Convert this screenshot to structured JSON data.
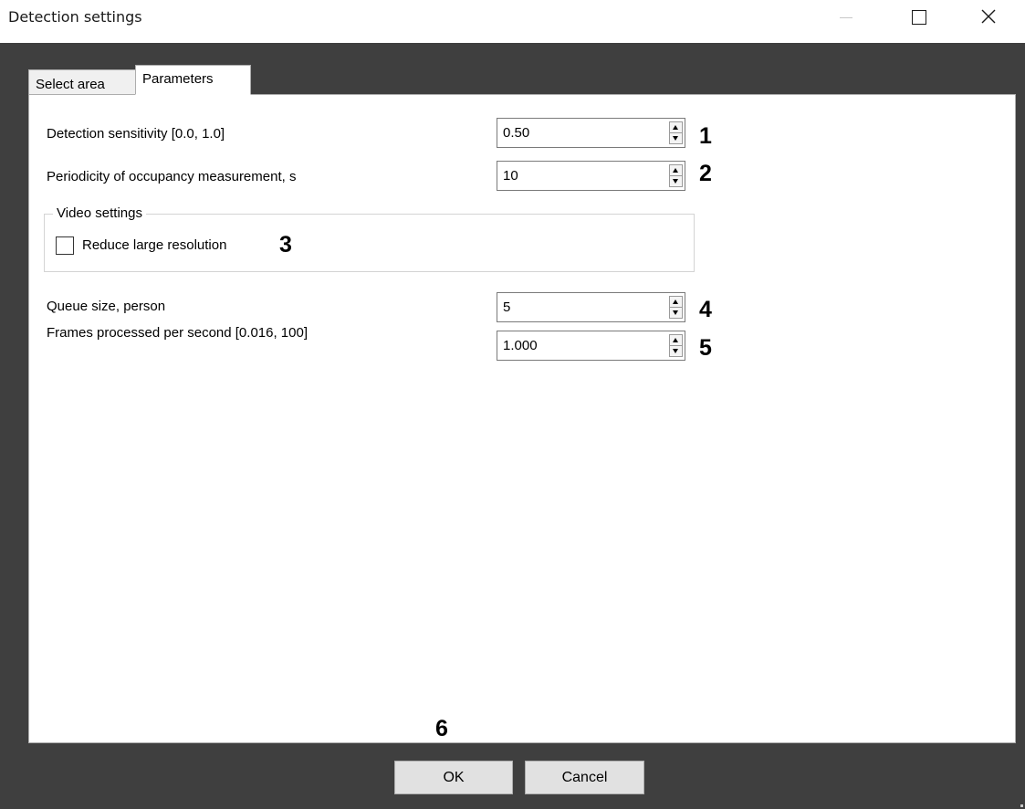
{
  "window": {
    "title": "Detection settings",
    "minimize_icon": "minimize-icon",
    "maximize_icon": "maximize-icon",
    "close_icon": "close-icon"
  },
  "tabs": [
    {
      "label": "Select area",
      "active": false
    },
    {
      "label": "Parameters",
      "active": true
    }
  ],
  "fields": {
    "sensitivity": {
      "label": "Detection sensitivity [0.0, 1.0]",
      "value": "0.50",
      "callout": "1"
    },
    "periodicity": {
      "label": "Periodicity of occupancy measurement, s",
      "value": "10",
      "callout": "2"
    },
    "queue_size": {
      "label": "Queue size, person",
      "value": "5",
      "callout": "4"
    },
    "fps": {
      "label": "Frames processed per second [0.016, 100]",
      "value": "1.000",
      "callout": "5"
    }
  },
  "video_settings": {
    "title": "Video settings",
    "reduce_resolution": {
      "label": "Reduce large resolution",
      "checked": false,
      "callout": "3"
    }
  },
  "buttons": {
    "ok_label": "OK",
    "cancel_label": "Cancel",
    "callout": "6"
  },
  "colors": {
    "frame": "#3f3f3f",
    "button_face": "#e1e1e1",
    "tab_inactive": "#f0f0f0"
  }
}
